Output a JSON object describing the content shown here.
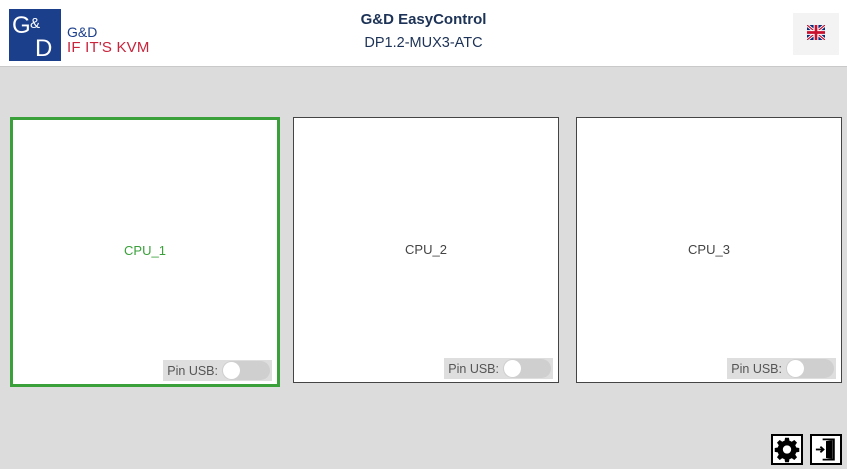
{
  "header": {
    "logo": {
      "mark": "G&D",
      "brand": "G&D",
      "slogan": "IF IT'S KVM"
    },
    "app_title": "G&D EasyControl",
    "device_name": "DP1.2-MUX3-ATC",
    "language_icon": "uk-flag-icon"
  },
  "channels": [
    {
      "name": "CPU_1",
      "active": true,
      "pin_usb_label": "Pin USB:",
      "pin_usb_on": false
    },
    {
      "name": "CPU_2",
      "active": false,
      "pin_usb_label": "Pin USB:",
      "pin_usb_on": false
    },
    {
      "name": "CPU_3",
      "active": false,
      "pin_usb_label": "Pin USB:",
      "pin_usb_on": false
    }
  ],
  "footer": {
    "settings_icon": "gear-icon",
    "logout_icon": "exit-door-icon"
  },
  "colors": {
    "brand_blue": "#1c3f8c",
    "brand_red": "#c8243c",
    "active_green": "#3aa03a",
    "background_gray": "#dcdcdc"
  }
}
